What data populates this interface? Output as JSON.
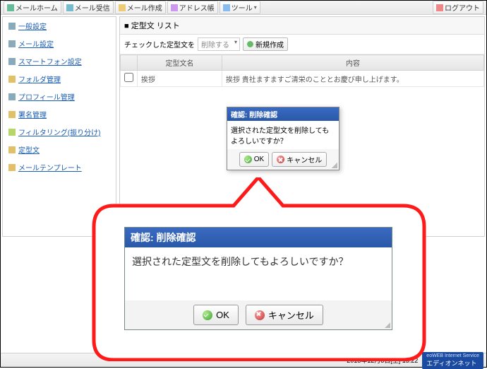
{
  "topbar": {
    "buttons": [
      {
        "label": "メールホーム"
      },
      {
        "label": "メール受信"
      },
      {
        "label": "メール作成"
      },
      {
        "label": "アドレス帳"
      },
      {
        "label": "ツール"
      }
    ],
    "logout": "ログアウト"
  },
  "sidebar": {
    "items": [
      {
        "label": "一般設定"
      },
      {
        "label": "メール設定"
      },
      {
        "label": "スマートフォン設定"
      },
      {
        "label": "フォルダ管理"
      },
      {
        "label": "プロフィール管理"
      },
      {
        "label": "署名管理"
      },
      {
        "label": "フィルタリング(振り分け)"
      },
      {
        "label": "定型文"
      },
      {
        "label": "メールテンプレート"
      }
    ]
  },
  "main": {
    "title": "■ 定型文  リスト",
    "toolbar": {
      "check_label": "チェックした定型文を",
      "action_select": "削除する",
      "new_button": "新規作成"
    },
    "table": {
      "columns": {
        "name": "定型文名",
        "content": "内容"
      },
      "rows": [
        {
          "name": "挨拶",
          "content": "挨拶  貴社ますますご清栄のこととお慶び申し上げます。"
        }
      ]
    }
  },
  "dialog_small": {
    "title": "確認: 削除確認",
    "message": "選択された定型文を削除してもよろしいですか？",
    "ok": "OK",
    "cancel": "キャンセル"
  },
  "dialog_large": {
    "title": "確認: 削除確認",
    "message": "選択された定型文を削除してもよろしいですか？",
    "ok": "OK",
    "cancel": "キャンセル"
  },
  "footer": {
    "timestamp": "2018年12月8日[土] 15:22",
    "brand_small": "eoWEB Internet Service",
    "brand": "エディオンネット"
  }
}
